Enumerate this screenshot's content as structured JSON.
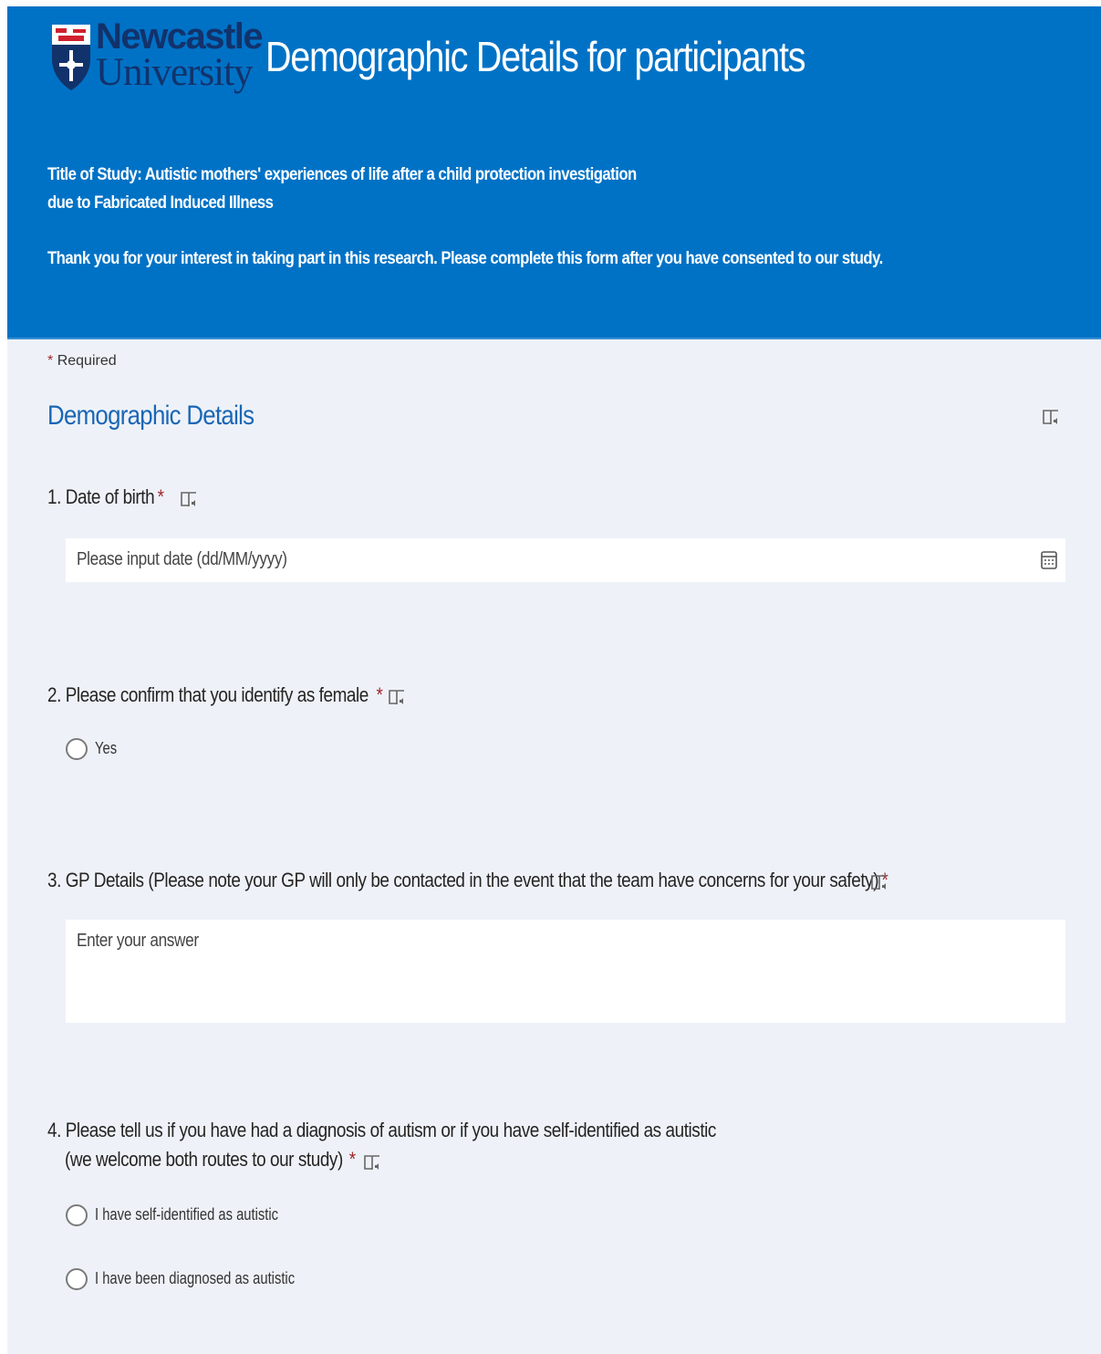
{
  "header": {
    "logo_line1": "Newcastle",
    "logo_line2": "University",
    "title": "Demographic Details for participants",
    "description_line1": "Title of Study: Autistic mothers' experiences of life after a child protection investigation",
    "description_line2": "due to Fabricated Induced Illness",
    "description_line3": "Thank you for your interest in taking part in this research. Please complete this form after you have consented to our study."
  },
  "required_note": {
    "star": "*",
    "text": "Required"
  },
  "section": {
    "title": "Demographic Details"
  },
  "questions": [
    {
      "title": "1. Date of birth",
      "required_mark": "*",
      "placeholder": "Please input date (dd/MM/yyyy)"
    },
    {
      "title": "2. Please confirm that you identify as female",
      "required_mark": "*",
      "options": [
        "Yes"
      ]
    },
    {
      "title": "3. GP Details (Please note your GP will only be contacted in the event that the team have concerns for your safety)",
      "required_mark": "*",
      "placeholder": "Enter your answer"
    },
    {
      "title_line1": "4. Please tell us if you have had a diagnosis of autism or if you have self-identified as autistic",
      "title_line2": "(we welcome both routes to our study)",
      "required_mark": "*",
      "options": [
        "I have self-identified as autistic",
        "I have been diagnosed as autistic"
      ]
    }
  ],
  "colors": {
    "banner": "#0072c6",
    "page_background": "#eef2f8",
    "section_title": "#1a66b5",
    "required": "#a4262c"
  },
  "icons": [
    "immersive-reader-icon",
    "calendar-icon",
    "shield-crest-icon"
  ]
}
